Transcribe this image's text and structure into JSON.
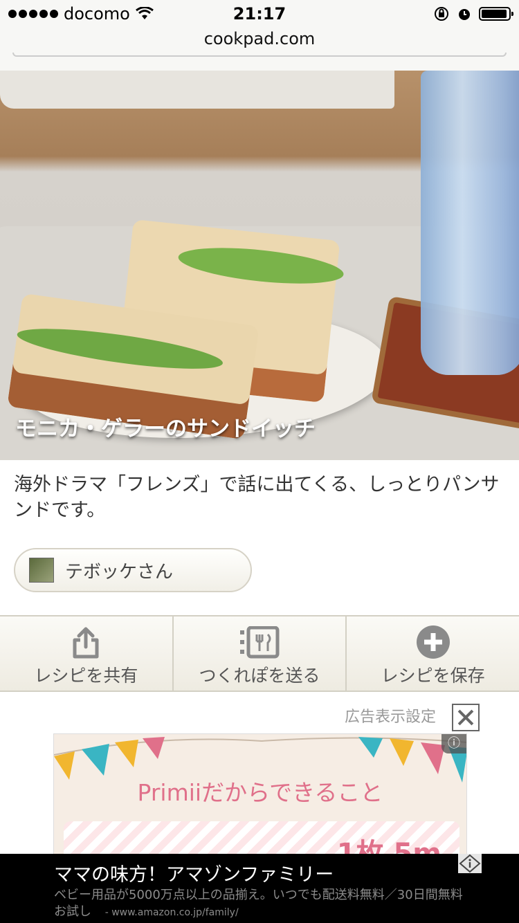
{
  "status_bar": {
    "carrier": "docomo",
    "time": "21:17"
  },
  "browser": {
    "url": "cookpad.com"
  },
  "recipe": {
    "title": "モニカ・ゲラーのサンドイッチ",
    "description": "海外ドラマ「フレンズ」で話に出てくる、しっとりパンサンドです。",
    "author_name": "テボッケさん"
  },
  "actions": [
    {
      "label": "レシピを共有",
      "icon": "share-icon"
    },
    {
      "label": "つくれぽを送る",
      "icon": "tsukurepo-icon"
    },
    {
      "label": "レシピを保存",
      "icon": "plus-circle-icon"
    }
  ],
  "ad_settings": {
    "label": "広告表示設定"
  },
  "ad_banner": {
    "title": "Primiiだからできること",
    "number": "1枚 5m",
    "colors": {
      "pink": "#e0708a",
      "teal": "#3ab5c3",
      "yellow": "#f1b62f"
    }
  },
  "bottom_ad": {
    "headline": "ママの味方！アマゾンファミリー",
    "text": "ベビー用品が5000万点以上の品揃え。いつでも配送料無料／30日間無料お試し",
    "domain": "- www.amazon.co.jp/family/"
  }
}
